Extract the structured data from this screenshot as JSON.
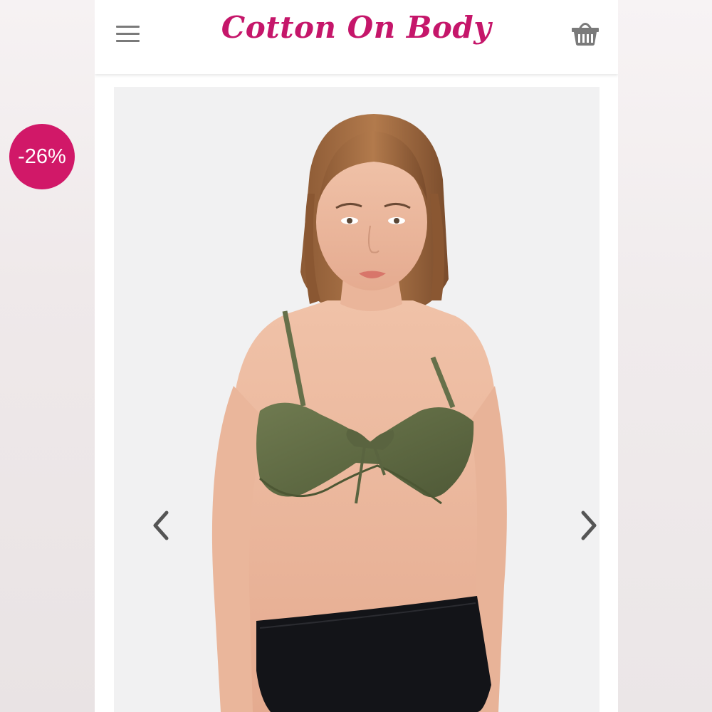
{
  "header": {
    "brand": "Cotton On Body",
    "menu_icon": "hamburger-menu-icon",
    "cart_icon": "shopping-basket-icon",
    "brand_color": "#c5166a"
  },
  "product": {
    "discount": "-26%",
    "badge_color": "#d11868",
    "image": "model wearing khaki green tie-front underwire bikini top with black high-waist bottoms",
    "prev_icon": "chevron-left-icon",
    "next_icon": "chevron-right-icon"
  }
}
